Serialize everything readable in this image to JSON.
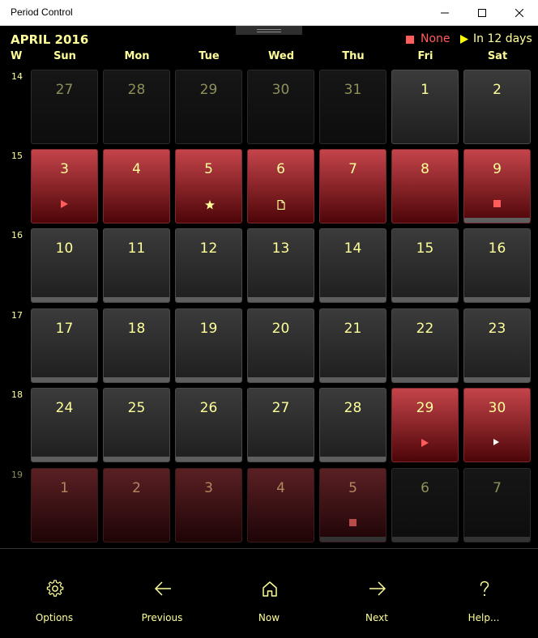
{
  "window": {
    "title": "Period Control"
  },
  "header": {
    "month_title": "APRIL 2016",
    "legend_red": "None",
    "legend_next": "In 12 days"
  },
  "weekdays": [
    "W",
    "Sun",
    "Mon",
    "Tue",
    "Wed",
    "Thu",
    "Fri",
    "Sat"
  ],
  "weeks": [
    {
      "number": "14",
      "days": [
        "27",
        "28",
        "29",
        "30",
        "31",
        "1",
        "2"
      ]
    },
    {
      "number": "15",
      "days": [
        "3",
        "4",
        "5",
        "6",
        "7",
        "8",
        "9"
      ]
    },
    {
      "number": "16",
      "days": [
        "10",
        "11",
        "12",
        "13",
        "14",
        "15",
        "16"
      ]
    },
    {
      "number": "17",
      "days": [
        "17",
        "18",
        "19",
        "20",
        "21",
        "22",
        "23"
      ]
    },
    {
      "number": "18",
      "days": [
        "24",
        "25",
        "26",
        "27",
        "28",
        "29",
        "30"
      ]
    },
    {
      "number": "19",
      "days": [
        "1",
        "2",
        "3",
        "4",
        "5",
        "6",
        "7"
      ]
    }
  ],
  "colors": {
    "accent_yellow": "#ffff99",
    "period_red": "#ff5c5c"
  },
  "icons": {
    "play_red": "play-icon",
    "star": "star-icon",
    "note": "note-icon",
    "stop_red": "stop-icon",
    "play_white": "play-icon"
  },
  "bottom_nav": {
    "options": "Options",
    "previous": "Previous",
    "now": "Now",
    "next": "Next",
    "help": "Help..."
  }
}
